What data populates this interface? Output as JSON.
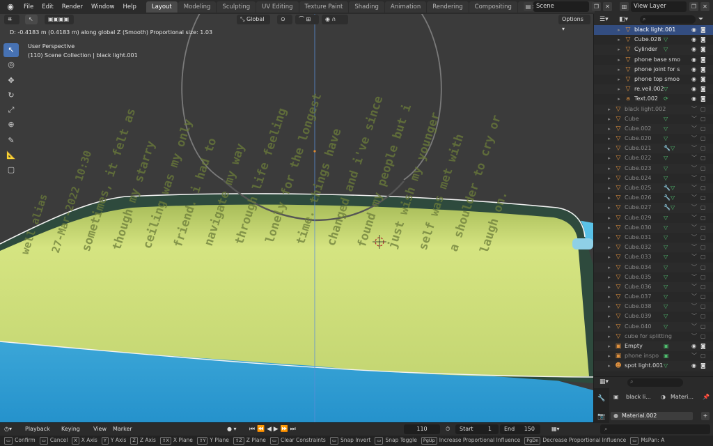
{
  "app": {
    "logo_icon": "blender-logo-icon",
    "accent": "#4772b3"
  },
  "menu": [
    "File",
    "Edit",
    "Render",
    "Window",
    "Help"
  ],
  "workspaces": [
    "Layout",
    "Modeling",
    "Sculpting",
    "UV Editing",
    "Texture Paint",
    "Shading",
    "Animation",
    "Rendering",
    "Compositing",
    "Geometry Nodes",
    "S"
  ],
  "active_workspace": "Layout",
  "scene": {
    "label": "Scene"
  },
  "view_layer": {
    "label": "View Layer"
  },
  "viewport": {
    "status_line": "D: -0.4183 m (0.4183 m) along global Z (Smooth)   Proportional size: 1.03",
    "perspective": "User Perspective",
    "collection_line": "(110) Scene Collection | black light.001",
    "orientation": "Global",
    "options_label": "Options",
    "screen_text_lines": [
      "well alias",
      "27-Mar-2022 10:30",
      "sometimes, it felt as",
      "though my starry",
      "ceiling was my only",
      "friend. i had to",
      "navigate my way",
      "through life feeling",
      "lonely for the longest",
      "time. things have",
      "changed and i've since",
      "found my people but i",
      "just wish my younger",
      "self was met with",
      "a shoulder to cry or",
      "laugh on."
    ],
    "colors": {
      "background": "#3b3b3b",
      "screen_green": "#c9dd78",
      "screen_blue": "#3aa7d9",
      "circle": "#7a7a7a",
      "axis_blue": "#5a8ed8"
    }
  },
  "outliner": {
    "search_placeholder": "",
    "rows": [
      {
        "name": "black light.001",
        "indent": 2,
        "icon": "▽",
        "arrow": "▸",
        "sel": true,
        "dim": false,
        "mod": ""
      },
      {
        "name": "Cube.028",
        "indent": 2,
        "icon": "▽",
        "arrow": "▸",
        "sel": false,
        "dim": false,
        "mod": "▽"
      },
      {
        "name": "Cylinder",
        "indent": 2,
        "icon": "▽",
        "arrow": "▸",
        "sel": false,
        "dim": false,
        "mod": "▽"
      },
      {
        "name": "phone base smo",
        "indent": 2,
        "icon": "▽",
        "arrow": "▸",
        "sel": false,
        "dim": false,
        "mod": ""
      },
      {
        "name": "phone joint for s",
        "indent": 2,
        "icon": "▽",
        "arrow": "▸",
        "sel": false,
        "dim": false,
        "mod": ""
      },
      {
        "name": "phone top smoo",
        "indent": 2,
        "icon": "▽",
        "arrow": "▸",
        "sel": false,
        "dim": false,
        "mod": ""
      },
      {
        "name": "re.veil.002",
        "indent": 2,
        "icon": "▽",
        "arrow": "▸",
        "sel": false,
        "dim": false,
        "mod": "▽"
      },
      {
        "name": "Text.002",
        "indent": 2,
        "icon": "a",
        "arrow": "▸",
        "sel": false,
        "dim": false,
        "mod": "⟳"
      },
      {
        "name": "black light.002",
        "indent": 1,
        "icon": "▽",
        "arrow": "▸",
        "sel": false,
        "dim": true,
        "mod": ""
      },
      {
        "name": "Cube",
        "indent": 1,
        "icon": "▽",
        "arrow": "▸",
        "sel": false,
        "dim": true,
        "mod": "▽"
      },
      {
        "name": "Cube.002",
        "indent": 1,
        "icon": "▽",
        "arrow": "▸",
        "sel": false,
        "dim": true,
        "mod": "▽"
      },
      {
        "name": "Cube.020",
        "indent": 1,
        "icon": "▽",
        "arrow": "▸",
        "sel": false,
        "dim": true,
        "mod": "▽"
      },
      {
        "name": "Cube.021",
        "indent": 1,
        "icon": "▽",
        "arrow": "▸",
        "sel": false,
        "dim": true,
        "mod": "🔧▽"
      },
      {
        "name": "Cube.022",
        "indent": 1,
        "icon": "▽",
        "arrow": "▸",
        "sel": false,
        "dim": true,
        "mod": "▽"
      },
      {
        "name": "Cube.023",
        "indent": 1,
        "icon": "▽",
        "arrow": "▸",
        "sel": false,
        "dim": true,
        "mod": "▽"
      },
      {
        "name": "Cube.024",
        "indent": 1,
        "icon": "▽",
        "arrow": "▸",
        "sel": false,
        "dim": true,
        "mod": "▽"
      },
      {
        "name": "Cube.025",
        "indent": 1,
        "icon": "▽",
        "arrow": "▸",
        "sel": false,
        "dim": true,
        "mod": "🔧▽"
      },
      {
        "name": "Cube.026",
        "indent": 1,
        "icon": "▽",
        "arrow": "▸",
        "sel": false,
        "dim": true,
        "mod": "🔧▽"
      },
      {
        "name": "Cube.027",
        "indent": 1,
        "icon": "▽",
        "arrow": "▸",
        "sel": false,
        "dim": true,
        "mod": "🔧▽"
      },
      {
        "name": "Cube.029",
        "indent": 1,
        "icon": "▽",
        "arrow": "▸",
        "sel": false,
        "dim": true,
        "mod": "▽"
      },
      {
        "name": "Cube.030",
        "indent": 1,
        "icon": "▽",
        "arrow": "▸",
        "sel": false,
        "dim": true,
        "mod": "▽"
      },
      {
        "name": "Cube.031",
        "indent": 1,
        "icon": "▽",
        "arrow": "▸",
        "sel": false,
        "dim": true,
        "mod": "▽"
      },
      {
        "name": "Cube.032",
        "indent": 1,
        "icon": "▽",
        "arrow": "▸",
        "sel": false,
        "dim": true,
        "mod": "▽"
      },
      {
        "name": "Cube.033",
        "indent": 1,
        "icon": "▽",
        "arrow": "▸",
        "sel": false,
        "dim": true,
        "mod": "▽"
      },
      {
        "name": "Cube.034",
        "indent": 1,
        "icon": "▽",
        "arrow": "▸",
        "sel": false,
        "dim": true,
        "mod": "▽"
      },
      {
        "name": "Cube.035",
        "indent": 1,
        "icon": "▽",
        "arrow": "▸",
        "sel": false,
        "dim": true,
        "mod": "▽"
      },
      {
        "name": "Cube.036",
        "indent": 1,
        "icon": "▽",
        "arrow": "▸",
        "sel": false,
        "dim": true,
        "mod": "▽"
      },
      {
        "name": "Cube.037",
        "indent": 1,
        "icon": "▽",
        "arrow": "▸",
        "sel": false,
        "dim": true,
        "mod": "▽"
      },
      {
        "name": "Cube.038",
        "indent": 1,
        "icon": "▽",
        "arrow": "▸",
        "sel": false,
        "dim": true,
        "mod": "▽"
      },
      {
        "name": "Cube.039",
        "indent": 1,
        "icon": "▽",
        "arrow": "▸",
        "sel": false,
        "dim": true,
        "mod": "▽"
      },
      {
        "name": "Cube.040",
        "indent": 1,
        "icon": "▽",
        "arrow": "▸",
        "sel": false,
        "dim": true,
        "mod": "▽"
      },
      {
        "name": "cube for splitting",
        "indent": 1,
        "icon": "▽",
        "arrow": "▸",
        "sel": false,
        "dim": true,
        "mod": ""
      },
      {
        "name": "Empty",
        "indent": 1,
        "icon": "▣",
        "arrow": "▸",
        "sel": false,
        "dim": false,
        "mod": "▣"
      },
      {
        "name": "phone inspo",
        "indent": 1,
        "icon": "▣",
        "arrow": "▸",
        "sel": false,
        "dim": true,
        "mod": "▣"
      },
      {
        "name": "spot light.001",
        "indent": 1,
        "icon": "☻",
        "arrow": "▸",
        "sel": false,
        "dim": false,
        "mod": "▽"
      }
    ]
  },
  "properties": {
    "object_name": "black li...",
    "material_label": "Materi...",
    "material_slot": "Material.002"
  },
  "timeline": {
    "playback": "Playback",
    "keying": "Keying",
    "view": "View",
    "marker": "Marker",
    "current_frame": "110",
    "start_label": "Start",
    "start": "1",
    "end_label": "End",
    "end": "150"
  },
  "statusbar": {
    "items": [
      {
        "key": "",
        "label": "Confirm"
      },
      {
        "key": "",
        "label": "Cancel"
      },
      {
        "key": "X",
        "label": "X Axis"
      },
      {
        "key": "Y",
        "label": "Y Axis"
      },
      {
        "key": "Z",
        "label": "Z Axis"
      },
      {
        "key": "⇧X",
        "label": "X Plane"
      },
      {
        "key": "⇧Y",
        "label": "Y Plane"
      },
      {
        "key": "⇧Z",
        "label": "Z Plane"
      },
      {
        "key": "",
        "label": "Clear Constraints"
      },
      {
        "key": "",
        "label": "Snap Invert"
      },
      {
        "key": "",
        "label": "Snap Toggle"
      },
      {
        "key": "PgUp",
        "label": "Increase Proportional Influence"
      },
      {
        "key": "PgDn",
        "label": "Decrease Proportional Influence"
      },
      {
        "key": "",
        "label": "MsPan: A"
      }
    ]
  }
}
